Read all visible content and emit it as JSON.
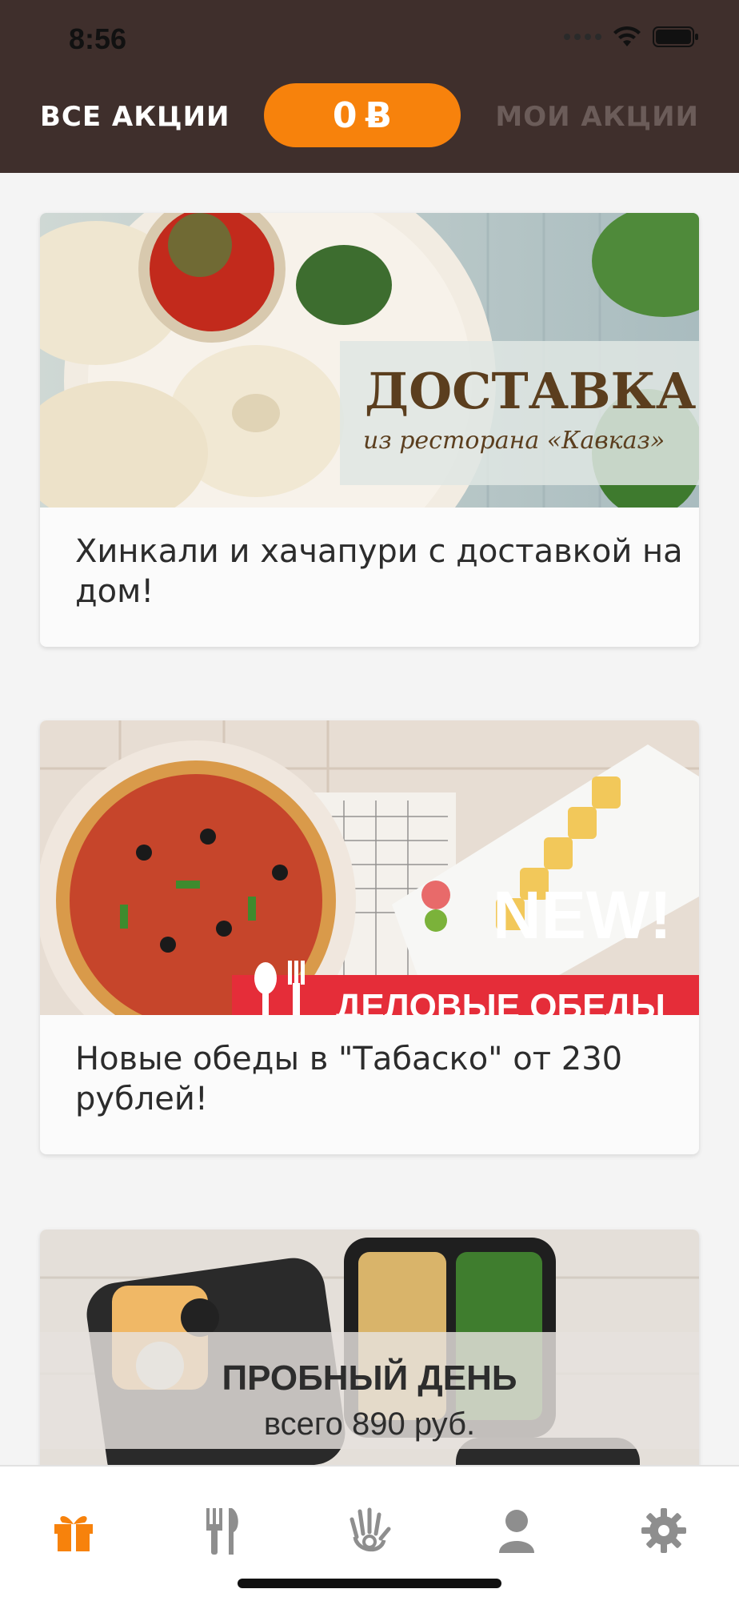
{
  "status_bar": {
    "time": "8:56"
  },
  "nav": {
    "all_label": "ВСЕ АКЦИИ",
    "points_value": "0",
    "points_symbol": "Ƀ",
    "mine_label": "МОИ АКЦИИ"
  },
  "cards": [
    {
      "banner_title": "ДОСТАВКА!",
      "banner_subtitle": "из ресторана «Кавказ»",
      "text": "Хинкали и хачапури с доставкой на дом!"
    },
    {
      "banner_badge": "NEW!",
      "banner_ribbon": "ДЕЛОВЫЕ ОБЕДЫ",
      "text": "Новые обеды в \"Табаско\" от 230 рублей!"
    },
    {
      "banner_title": "ПРОБНЫЙ ДЕНЬ",
      "banner_subtitle": "всего 890 руб."
    }
  ],
  "tabs": [
    {
      "icon": "gift-icon",
      "active": true
    },
    {
      "icon": "restaurant-icon",
      "active": false
    },
    {
      "icon": "hand-icon",
      "active": false
    },
    {
      "icon": "profile-icon",
      "active": false
    },
    {
      "icon": "gear-icon",
      "active": false
    }
  ],
  "colors": {
    "header_bg": "#3f2f2c",
    "accent": "#f7820c",
    "inactive_nav": "#6b5c59",
    "tab_inactive": "#8e8e8e"
  }
}
